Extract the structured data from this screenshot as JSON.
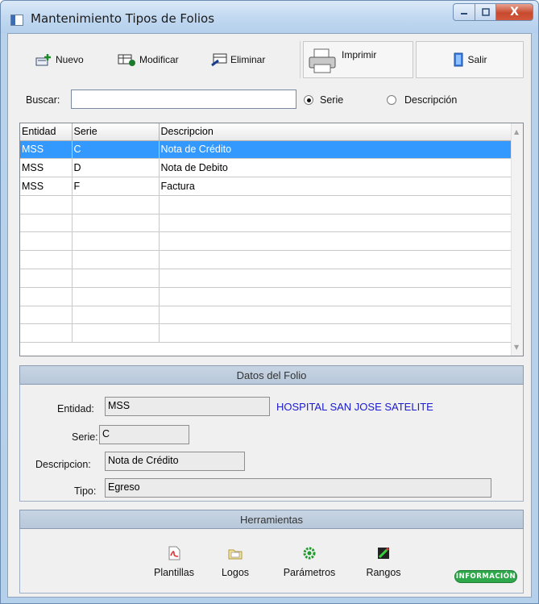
{
  "window": {
    "title": "Mantenimiento Tipos de Folios",
    "close_glyph": "X"
  },
  "toolbar": {
    "nuevo": "Nuevo",
    "modificar": "Modificar",
    "eliminar": "Eliminar",
    "imprimir": "Imprimir",
    "salir": "Salir"
  },
  "search": {
    "label": "Buscar:",
    "value": "",
    "options": [
      {
        "label": "Serie",
        "selected": true
      },
      {
        "label": "Descripción",
        "selected": false
      }
    ]
  },
  "grid": {
    "columns": [
      "Entidad",
      "Serie",
      "Descripcion"
    ],
    "rows": [
      [
        "MSS",
        "C",
        "Nota de Crédito"
      ],
      [
        "MSS",
        "D",
        "Nota de Debito"
      ],
      [
        "MSS",
        "F",
        "Factura"
      ]
    ],
    "selected_row": 0,
    "empty_rows": 9
  },
  "datos": {
    "header": "Datos del Folio",
    "entidad_label": "Entidad:",
    "entidad_value": "MSS",
    "entidad_name": "HOSPITAL SAN JOSE SATELITE",
    "serie_label": "Serie:",
    "serie_value": "C",
    "descripcion_label": "Descripcion:",
    "descripcion_value": "Nota de Crédito",
    "tipo_label": "Tipo:",
    "tipo_value": "Egreso"
  },
  "herramientas": {
    "header": "Herramientas",
    "plantillas": "Plantillas",
    "logos": "Logos",
    "parametros": "Parámetros",
    "rangos": "Rangos",
    "informacion": "INFORMACIÓN"
  },
  "colors": {
    "selection": "#3399ff",
    "entity_name": "#1a1ad0",
    "info_badge": "#2ea84a"
  }
}
